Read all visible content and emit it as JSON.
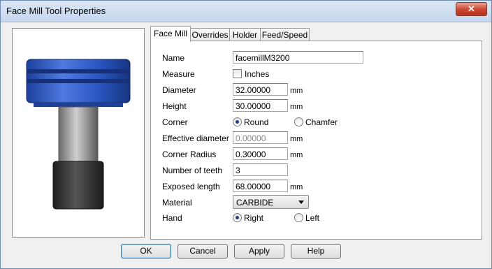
{
  "window": {
    "title": "Face Mill Tool Properties",
    "close_glyph": "✕"
  },
  "tabs": [
    "Face Mill",
    "Overrides",
    "Holder",
    "Feed/Speed"
  ],
  "fields": {
    "name": {
      "label": "Name",
      "value": "facemillM3200"
    },
    "measure": {
      "label": "Measure",
      "checkbox_label": "Inches",
      "checked": false
    },
    "diameter": {
      "label": "Diameter",
      "value": "32.00000",
      "unit": "mm"
    },
    "height": {
      "label": "Height",
      "value": "30.00000",
      "unit": "mm"
    },
    "corner": {
      "label": "Corner",
      "options": [
        "Round",
        "Chamfer"
      ],
      "selected": "Round"
    },
    "effective_diameter": {
      "label": "Effective diameter",
      "value": "0.00000",
      "unit": "mm",
      "disabled": true
    },
    "corner_radius": {
      "label": "Corner Radius",
      "value": "0.30000",
      "unit": "mm"
    },
    "teeth": {
      "label": "Number of teeth",
      "value": "3"
    },
    "exposed_length": {
      "label": "Exposed length",
      "value": "68.00000",
      "unit": "mm"
    },
    "material": {
      "label": "Material",
      "value": "CARBIDE"
    },
    "hand": {
      "label": "Hand",
      "options": [
        "Right",
        "Left"
      ],
      "selected": "Right"
    }
  },
  "buttons": {
    "ok": "OK",
    "cancel": "Cancel",
    "apply": "Apply",
    "help": "Help"
  },
  "colors": {
    "tool_blue": "#2a56c2",
    "shank_gray": "#9a9a9a",
    "holder_dark": "#3a3a3a"
  }
}
